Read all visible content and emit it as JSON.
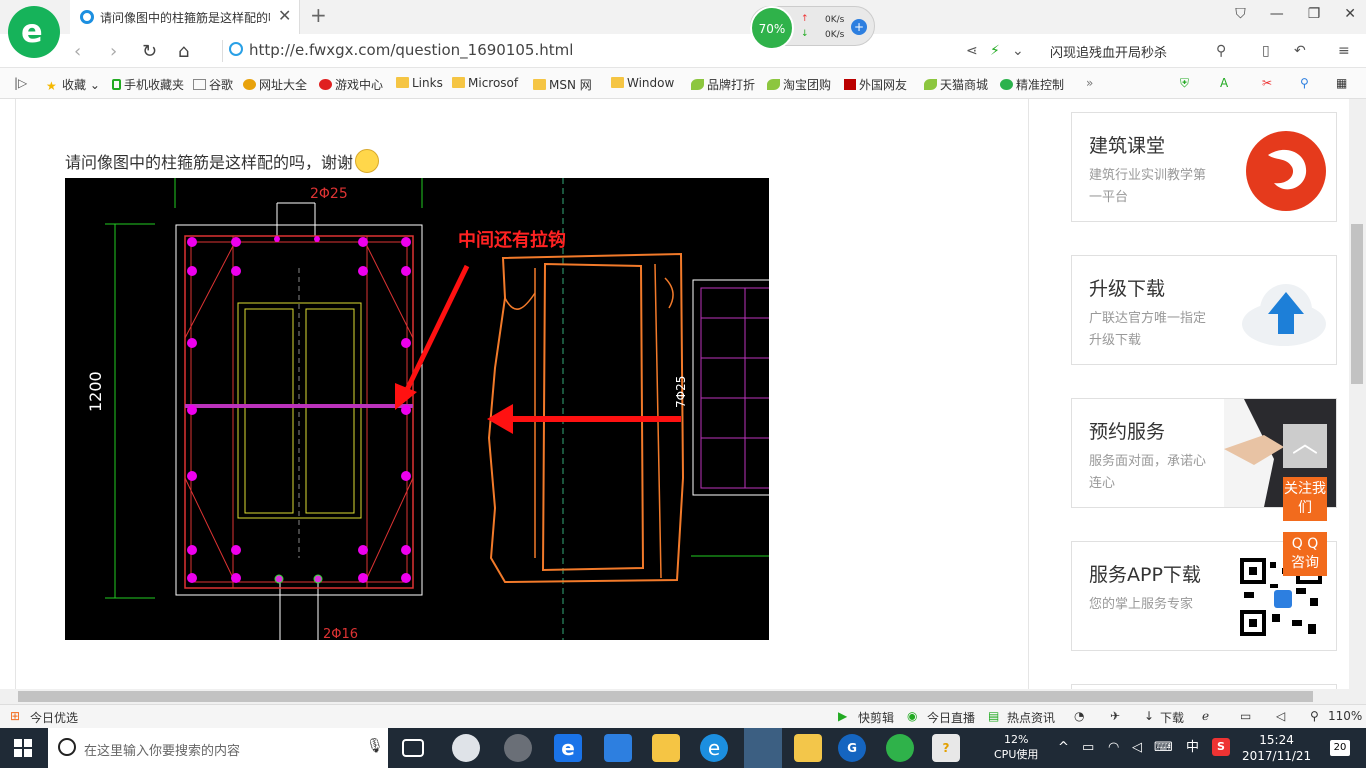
{
  "browser": {
    "tab_title": "请问像图中的柱箍筋是这样配的吗",
    "url": "http://e.fwxgx.com/question_1690105.html",
    "search_hint": "闪现追残血开局秒杀",
    "speed_pct": "70%",
    "up_speed": "0K/s",
    "down_speed": "0K/s"
  },
  "favorites": [
    "收藏",
    "手机收藏夹",
    "谷歌",
    "网址大全",
    "游戏中心",
    "Links",
    "Microsof",
    "MSN 网",
    "Window",
    "品牌打折",
    "淘宝团购",
    "外国网友",
    "天猫商城",
    "精准控制"
  ],
  "main": {
    "question": "请问像图中的柱箍筋是这样配的吗，谢谢",
    "cad_note": "中间还有拉钩",
    "cad_top_label": "2Φ25",
    "cad_bottom_label": "2Φ16",
    "cad_dim": "1200",
    "cad_side_label": "7Φ25"
  },
  "sidebar": {
    "cards": [
      {
        "title": "建筑课堂",
        "desc": "建筑行业实训教学第一平台"
      },
      {
        "title": "升级下载",
        "desc": "广联达官方唯一指定升级下载"
      },
      {
        "title": "预约服务",
        "desc": "服务面对面，承诺心连心"
      },
      {
        "title": "服务APP下载",
        "desc": "您的掌上服务专家"
      }
    ],
    "follow": "关注我们",
    "qq": "Q Q 咨询"
  },
  "statusbar": {
    "left": "今日优选",
    "items": [
      "快剪辑",
      "今日直播",
      "热点资讯"
    ],
    "download": "下载",
    "zoom": "110%"
  },
  "taskbar": {
    "search_placeholder": "在这里输入你要搜索的内容",
    "cpu_pct": "12%",
    "cpu_label": "CPU使用",
    "ime": "中",
    "time": "15:24",
    "date": "2017/11/21",
    "notifications": "20"
  },
  "colors": {
    "accent": "#16b35a",
    "orange": "#f26b1d",
    "cad_bg": "#000000"
  }
}
